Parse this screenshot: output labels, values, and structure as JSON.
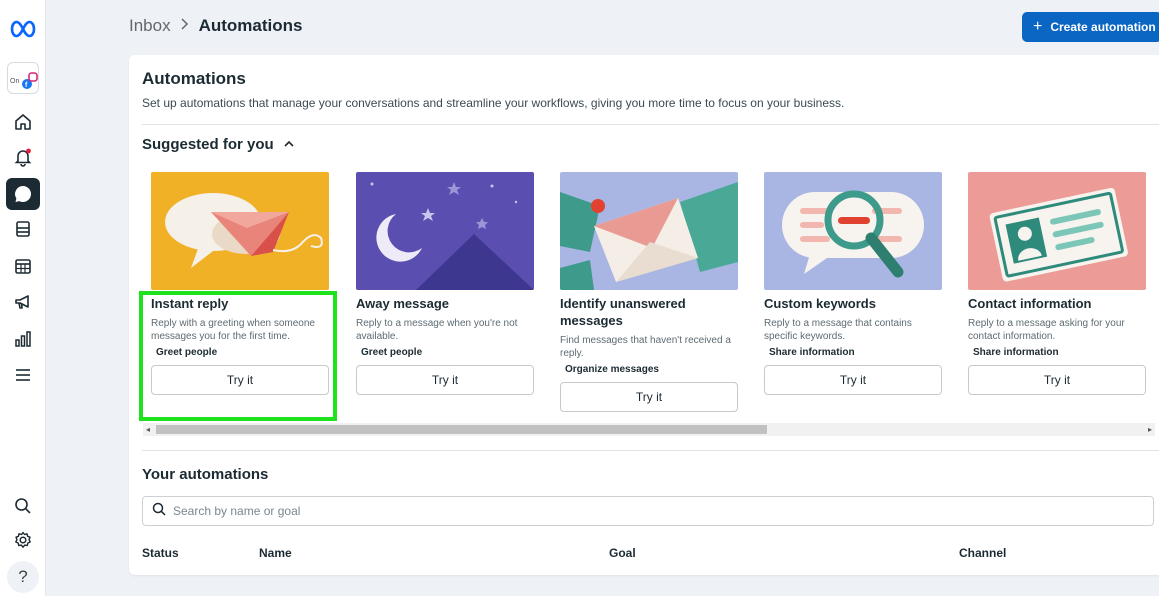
{
  "header": {
    "breadcrumb": [
      "Inbox",
      "Automations"
    ],
    "breadcrumb_separator": ">",
    "create_button": "Create automation",
    "create_icon": "+"
  },
  "sidebar": {
    "items": [
      {
        "icon": "meta-logo-icon"
      },
      {
        "icon": "account-switcher-icon"
      },
      {
        "icon": "home-icon"
      },
      {
        "icon": "notifications-icon"
      },
      {
        "icon": "inbox-icon",
        "active": true
      },
      {
        "icon": "content-icon"
      },
      {
        "icon": "planner-icon"
      },
      {
        "icon": "ads-icon"
      },
      {
        "icon": "insights-icon"
      },
      {
        "icon": "menu-icon"
      },
      {
        "icon": "search-icon"
      },
      {
        "icon": "settings-icon"
      },
      {
        "icon": "help-icon",
        "label": "?"
      }
    ]
  },
  "main": {
    "title": "Automations",
    "description": "Set up automations that manage your conversations and streamline your workflows, giving you more time to focus on your business.",
    "suggested_title": "Suggested for you",
    "cards": [
      {
        "title": "Instant reply",
        "description": "Reply with a greeting when someone messages you for the first time.",
        "tag": "Greet people",
        "button": "Try it"
      },
      {
        "title": "Away message",
        "description": "Reply to a message when you're not available.",
        "tag": "Greet people",
        "button": "Try it"
      },
      {
        "title": "Identify unanswered messages",
        "description": "Find messages that haven't received a reply.",
        "tag": "Organize messages",
        "button": "Try it"
      },
      {
        "title": "Custom keywords",
        "description": "Reply to a message that contains specific keywords.",
        "tag": "Share information",
        "button": "Try it"
      },
      {
        "title": "Contact information",
        "description": "Reply to a message asking for your contact information.",
        "tag": "Share information",
        "button": "Try it"
      }
    ],
    "your_automations_title": "Your automations",
    "search_placeholder": "Search by name or goal",
    "table_headers": [
      "Status",
      "Name",
      "Goal",
      "Channel"
    ]
  },
  "colors": {
    "accent": "#0a66c2",
    "highlight": "#1fe21f",
    "active_nav": "#1c2b33"
  }
}
